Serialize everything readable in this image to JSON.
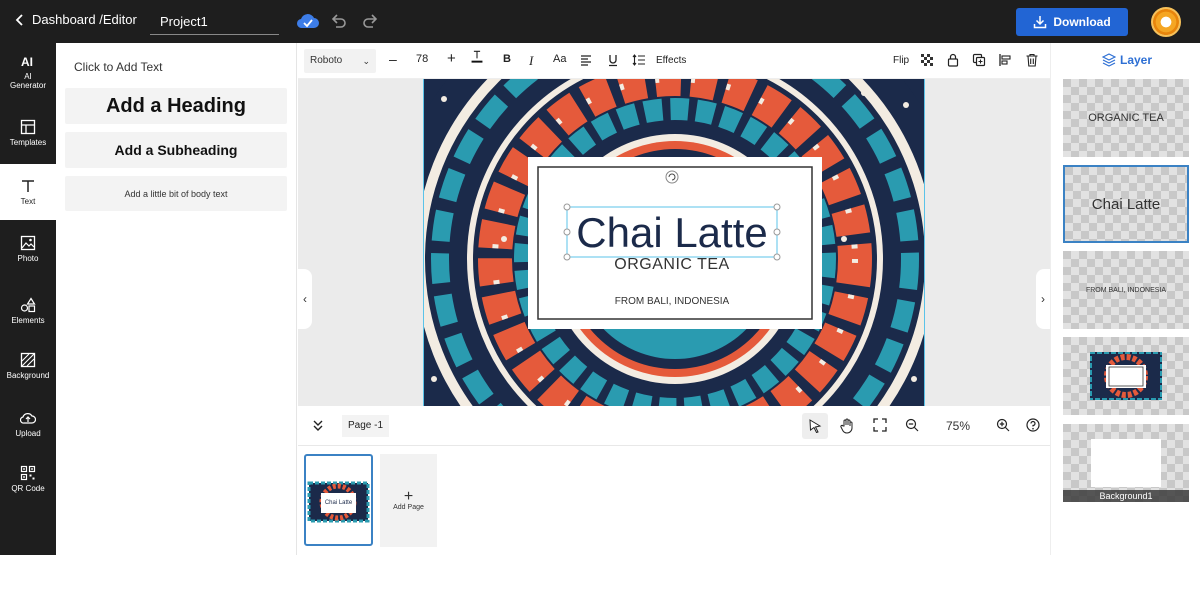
{
  "topbar": {
    "breadcrumb": "Dashboard /Editor",
    "project_name": "Project1",
    "download_label": "Download",
    "accent": "#2265d4"
  },
  "sidebar": {
    "items": [
      {
        "label": "AI\nGenerator",
        "icon": "ai-icon"
      },
      {
        "label": "Templates",
        "icon": "templates-icon"
      },
      {
        "label": "Text",
        "icon": "text-icon"
      },
      {
        "label": "Photo",
        "icon": "photo-icon"
      },
      {
        "label": "Elements",
        "icon": "elements-icon"
      },
      {
        "label": "Background",
        "icon": "background-icon"
      },
      {
        "label": "Upload",
        "icon": "upload-icon"
      },
      {
        "label": "QR Code",
        "icon": "qr-icon"
      }
    ]
  },
  "text_panel": {
    "title": "Click to Add Text",
    "heading": "Add a Heading",
    "subheading": "Add a Subheading",
    "body": "Add a little bit of body text"
  },
  "toolbar": {
    "font": "Roboto",
    "size": "78",
    "aa": "Aa",
    "effects": "Effects",
    "flip": "Flip"
  },
  "design": {
    "title": "Chai Latte",
    "subtitle": "ORGANIC TEA",
    "origin": "FROM BALI, INDONESIA",
    "colors": {
      "navy": "#1b2a4a",
      "teal": "#2a9bb0",
      "orange": "#e55a3b",
      "cream": "#f3ece2"
    }
  },
  "pagebar": {
    "page_label": "Page -1",
    "zoom": "75%"
  },
  "thumbs": {
    "add_page": "Add Page",
    "thumb_title": "Chai Latte"
  },
  "layers": {
    "title": "Layer",
    "items": [
      "ORGANIC TEA",
      "Chai Latte",
      "FROM BALI, INDONESIA",
      "Background1"
    ]
  }
}
